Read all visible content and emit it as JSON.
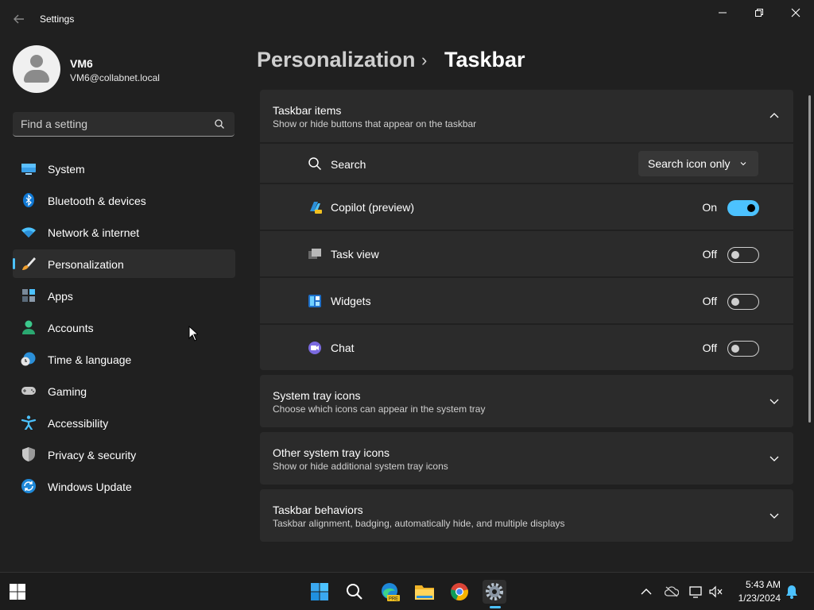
{
  "window": {
    "title": "Settings"
  },
  "profile": {
    "name": "VM6",
    "email": "VM6@collabnet.local"
  },
  "search": {
    "placeholder": "Find a setting",
    "value": ""
  },
  "sidebar": {
    "items": [
      {
        "label": "System",
        "icon": "monitor-icon"
      },
      {
        "label": "Bluetooth & devices",
        "icon": "bluetooth-icon"
      },
      {
        "label": "Network & internet",
        "icon": "wifi-icon"
      },
      {
        "label": "Personalization",
        "icon": "brush-icon",
        "active": true
      },
      {
        "label": "Apps",
        "icon": "apps-icon"
      },
      {
        "label": "Accounts",
        "icon": "person-icon"
      },
      {
        "label": "Time & language",
        "icon": "globe-clock-icon"
      },
      {
        "label": "Gaming",
        "icon": "gamepad-icon"
      },
      {
        "label": "Accessibility",
        "icon": "accessibility-icon"
      },
      {
        "label": "Privacy & security",
        "icon": "shield-icon"
      },
      {
        "label": "Windows Update",
        "icon": "sync-icon"
      }
    ]
  },
  "header": {
    "parent": "Personalization",
    "separator": "›",
    "current": "Taskbar"
  },
  "sections": {
    "taskbar_items": {
      "title": "Taskbar items",
      "subtitle": "Show or hide buttons that appear on the taskbar",
      "expanded": true,
      "search": {
        "label": "Search",
        "value": "Search icon only"
      },
      "copilot": {
        "label": "Copilot (preview)",
        "state": "On"
      },
      "task_view": {
        "label": "Task view",
        "state": "Off"
      },
      "widgets": {
        "label": "Widgets",
        "state": "Off"
      },
      "chat": {
        "label": "Chat",
        "state": "Off"
      }
    },
    "system_tray": {
      "title": "System tray icons",
      "subtitle": "Choose which icons can appear in the system tray"
    },
    "other_tray": {
      "title": "Other system tray icons",
      "subtitle": "Show or hide additional system tray icons"
    },
    "behaviors": {
      "title": "Taskbar behaviors",
      "subtitle": "Taskbar alignment, badging, automatically hide, and multiple displays"
    }
  },
  "taskbar": {
    "time": "5:43 AM",
    "date": "1/23/2024",
    "apps": [
      "start-icon",
      "search-icon",
      "edge-icon",
      "file-explorer-icon",
      "chrome-icon",
      "settings-gear-icon"
    ]
  },
  "colors": {
    "accent": "#4cc2ff",
    "background": "#202020",
    "card": "#2b2b2b"
  }
}
